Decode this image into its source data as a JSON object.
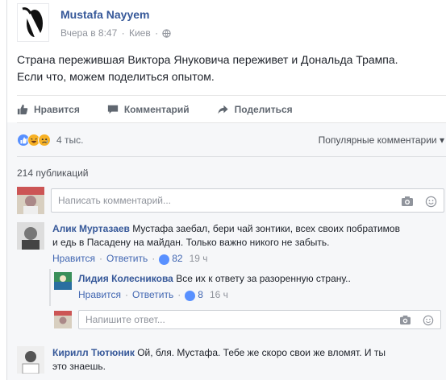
{
  "post": {
    "author": "Mustafa Nayyem",
    "time": "Вчера в 8:47",
    "place": "Киев",
    "separator": "·",
    "text_line1": "Страна пережившая Виктора Януковича переживет и Дональда Трампа.",
    "text_line2": "Если что, можем поделиться опытом."
  },
  "actions": {
    "like": "Нравится",
    "comment": "Комментарий",
    "share": "Поделиться"
  },
  "reactions": {
    "count": "4 тыс.",
    "sort_label": "Популярные комментарии",
    "sort_arrow": "▾",
    "icons": [
      "like-icon",
      "haha-icon",
      "sad-icon"
    ]
  },
  "shares": "214 публикаций",
  "comment_input": {
    "placeholder": "Написать комментарий..."
  },
  "reply_input": {
    "placeholder": "Напишите ответ..."
  },
  "comments": [
    {
      "author": "Алик Муртазаев",
      "text_line1": "Мустафа заебал, бери чай зонтики, всех своих побратимов",
      "text_line2": "и едь в Пасадену на майдан. Только важно никого не забыть.",
      "like": "Нравится",
      "reply": "Ответить",
      "likes": "82",
      "age": "19 ч"
    },
    {
      "author": "Лидия Колесникова",
      "text_line1": "Все их к ответу за разоренную страну..",
      "like": "Нравится",
      "reply": "Ответить",
      "likes": "8",
      "age": "16 ч"
    },
    {
      "author": "Кирилл Тютюник",
      "text_line1": "Ой, бля. Мустафа. Тебе же скоро свои же вломят. И ты",
      "text_line2": "это знаешь."
    }
  ],
  "colors": {
    "link": "#365899",
    "meta": "#90949c",
    "like_blue": "#5890ff",
    "emoji_yellow": "#f7b125"
  }
}
